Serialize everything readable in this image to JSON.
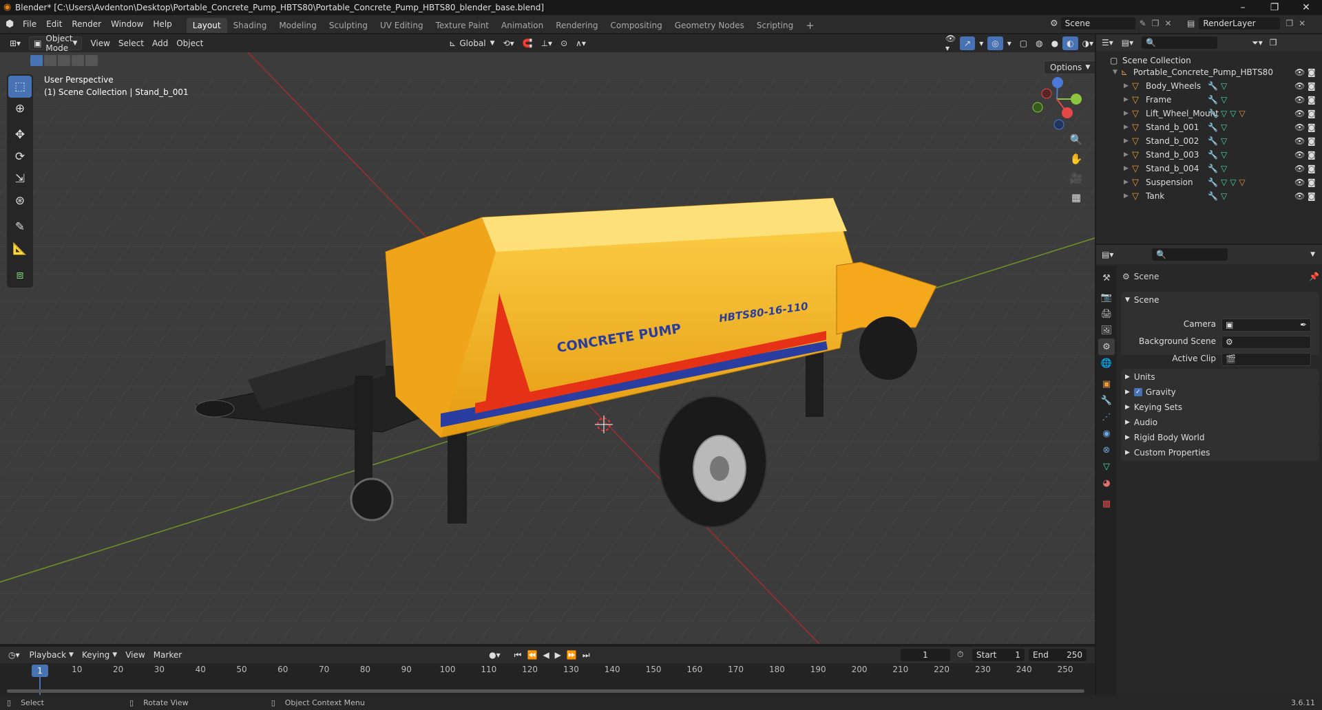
{
  "titlebar": {
    "title": "Blender* [C:\\Users\\Avdenton\\Desktop\\Portable_Concrete_Pump_HBTS80\\Portable_Concrete_Pump_HBTS80_blender_base.blend]"
  },
  "menus": [
    "File",
    "Edit",
    "Render",
    "Window",
    "Help"
  ],
  "workspaces": [
    "Layout",
    "Shading",
    "Modeling",
    "Sculpting",
    "UV Editing",
    "Texture Paint",
    "Animation",
    "Rendering",
    "Compositing",
    "Geometry Nodes",
    "Scripting"
  ],
  "scene_field": "Scene",
  "viewlayer_field": "RenderLayer",
  "viewport_header": {
    "mode": "Object Mode",
    "menus": [
      "View",
      "Select",
      "Add",
      "Object"
    ],
    "orientation": "Global",
    "options": "Options"
  },
  "viewport": {
    "perspective": "User Perspective",
    "collection_info": "(1) Scene Collection | Stand_b_001",
    "model_label_1": "CONCRETE PUMP",
    "model_label_2": "HBTS80-16-110"
  },
  "outliner": {
    "root": "Scene Collection",
    "collection": "Portable_Concrete_Pump_HBTS80",
    "objects": [
      "Body_Wheels",
      "Frame",
      "Lift_Wheel_Mount",
      "Stand_b_001",
      "Stand_b_002",
      "Stand_b_003",
      "Stand_b_004",
      "Suspension",
      "Tank"
    ],
    "selected": "Stand_b_001"
  },
  "properties": {
    "header": "Scene",
    "panel": "Scene",
    "camera_label": "Camera",
    "bg_scene_label": "Background Scene",
    "active_clip_label": "Active Clip",
    "subpanels": [
      "Units",
      "Gravity",
      "Keying Sets",
      "Audio",
      "Rigid Body World",
      "Custom Properties"
    ]
  },
  "timeline": {
    "menus": [
      "Playback",
      "Keying",
      "View",
      "Marker"
    ],
    "current_frame": "1",
    "start_label": "Start",
    "start": "1",
    "end_label": "End",
    "end": "250",
    "ticks": [
      "1",
      "10",
      "20",
      "30",
      "40",
      "50",
      "60",
      "70",
      "80",
      "90",
      "100",
      "110",
      "120",
      "130",
      "140",
      "150",
      "160",
      "170",
      "180",
      "190",
      "200",
      "210",
      "220",
      "230",
      "240",
      "250"
    ]
  },
  "statusbar": {
    "select": "Select",
    "rotate": "Rotate View",
    "context": "Object Context Menu",
    "version": "3.6.11"
  },
  "colors": {
    "accent": "#4772b3",
    "object": "#e89a3c",
    "mesh": "#44d8a8",
    "pump_body": "#f5a81c"
  }
}
